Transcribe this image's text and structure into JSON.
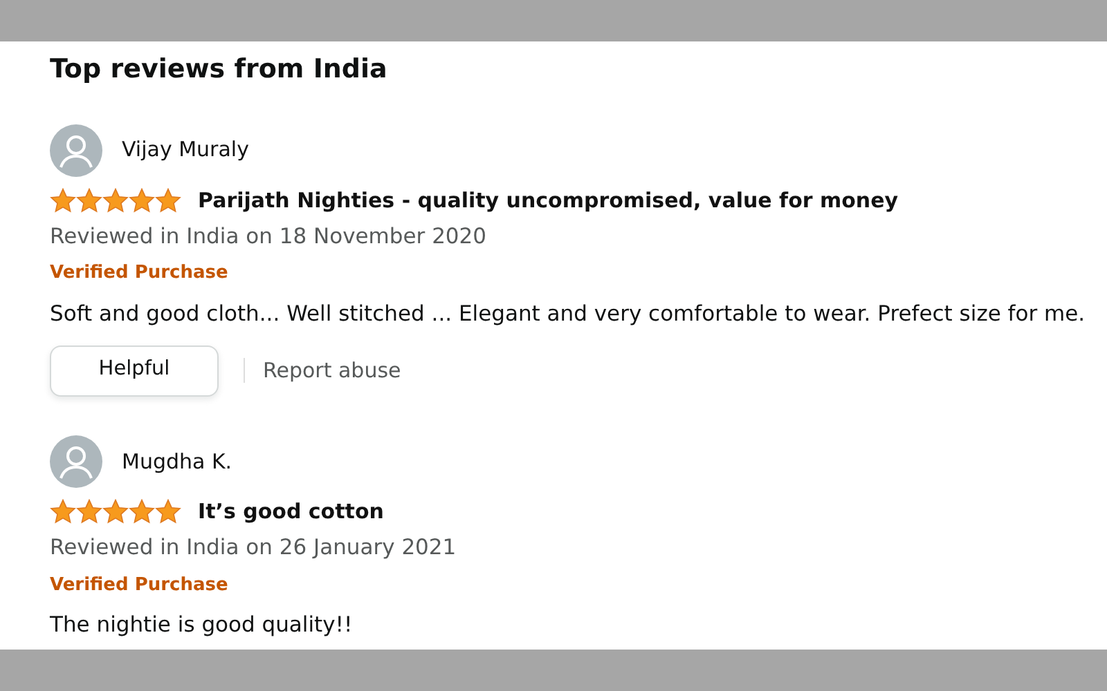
{
  "heading": "Top reviews from India",
  "reviews": [
    {
      "author": "Vijay Muraly",
      "stars": 5,
      "title": "Parijath Nighties - quality uncompromised, value for money",
      "date": "Reviewed in India on 18 November 2020",
      "badge": "Verified Purchase",
      "body": "Soft and good cloth... Well stitched ... Elegant and very comfortable to wear. Prefect size for me.",
      "actions": {
        "helpful": "Helpful",
        "report": "Report abuse"
      }
    },
    {
      "author": "Mugdha K.",
      "stars": 5,
      "title": "It’s good cotton",
      "date": "Reviewed in India on 26 January 2021",
      "badge": "Verified Purchase",
      "body": "The nightie is good quality!!"
    }
  ]
}
